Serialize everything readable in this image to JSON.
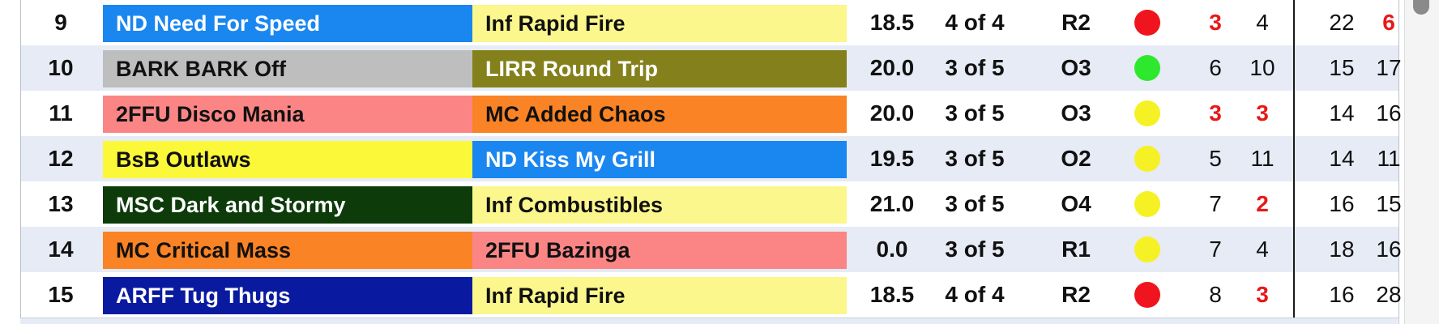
{
  "rows": [
    {
      "num": "9",
      "team1": "ND Need For Speed",
      "team1_bg": "#1a86f0",
      "team1_fg": "#ffffff",
      "team2": "Inf Rapid Fire",
      "team2_bg": "#fbf78c",
      "team2_fg": "#111111",
      "score": "18.5",
      "record": "4 of 4",
      "class": "R2",
      "status_color": "#f0141e",
      "v1": "3",
      "v1_red": true,
      "v2": "4",
      "v2_red": false,
      "v3": "22",
      "v3_red": false,
      "v4": "6",
      "v4_red": true
    },
    {
      "num": "10",
      "team1": "BARK BARK Off",
      "team1_bg": "#bebebe",
      "team1_fg": "#111111",
      "team2": "LIRR Round Trip",
      "team2_bg": "#84801c",
      "team2_fg": "#ffffff",
      "score": "20.0",
      "record": "3 of 5",
      "class": "O3",
      "status_color": "#2ee82e",
      "v1": "6",
      "v1_red": false,
      "v2": "10",
      "v2_red": false,
      "v3": "15",
      "v3_red": false,
      "v4": "17",
      "v4_red": false
    },
    {
      "num": "11",
      "team1": "2FFU Disco Mania",
      "team1_bg": "#fb8585",
      "team1_fg": "#111111",
      "team2": "MC Added Chaos",
      "team2_bg": "#f98325",
      "team2_fg": "#111111",
      "score": "20.0",
      "record": "3 of 5",
      "class": "O3",
      "status_color": "#f6f124",
      "v1": "3",
      "v1_red": true,
      "v2": "3",
      "v2_red": true,
      "v3": "14",
      "v3_red": false,
      "v4": "16",
      "v4_red": false
    },
    {
      "num": "12",
      "team1": "BsB Outlaws",
      "team1_bg": "#fbf83a",
      "team1_fg": "#111111",
      "team2": "ND Kiss My Grill",
      "team2_bg": "#1a86f0",
      "team2_fg": "#ffffff",
      "score": "19.5",
      "record": "3 of 5",
      "class": "O2",
      "status_color": "#f6f124",
      "v1": "5",
      "v1_red": false,
      "v2": "11",
      "v2_red": false,
      "v3": "14",
      "v3_red": false,
      "v4": "11",
      "v4_red": false
    },
    {
      "num": "13",
      "team1": "MSC Dark and Stormy",
      "team1_bg": "#0d3b0a",
      "team1_fg": "#ffffff",
      "team2": "Inf Combustibles",
      "team2_bg": "#fbf78c",
      "team2_fg": "#111111",
      "score": "21.0",
      "record": "3 of 5",
      "class": "O4",
      "status_color": "#f6f124",
      "v1": "7",
      "v1_red": false,
      "v2": "2",
      "v2_red": true,
      "v3": "16",
      "v3_red": false,
      "v4": "15",
      "v4_red": false
    },
    {
      "num": "14",
      "team1": "MC Critical Mass",
      "team1_bg": "#f98325",
      "team1_fg": "#111111",
      "team2": "2FFU Bazinga",
      "team2_bg": "#fb8585",
      "team2_fg": "#111111",
      "score": "0.0",
      "record": "3 of 5",
      "class": "R1",
      "status_color": "#f6f124",
      "v1": "7",
      "v1_red": false,
      "v2": "4",
      "v2_red": false,
      "v3": "18",
      "v3_red": false,
      "v4": "16",
      "v4_red": false
    },
    {
      "num": "15",
      "team1": "ARFF Tug Thugs",
      "team1_bg": "#0a1aa0",
      "team1_fg": "#ffffff",
      "team2": "Inf Rapid Fire",
      "team2_bg": "#fbf78c",
      "team2_fg": "#111111",
      "score": "18.5",
      "record": "4 of 4",
      "class": "R2",
      "status_color": "#f0141e",
      "v1": "8",
      "v1_red": false,
      "v2": "3",
      "v2_red": true,
      "v3": "16",
      "v3_red": false,
      "v4": "28",
      "v4_red": false
    }
  ]
}
